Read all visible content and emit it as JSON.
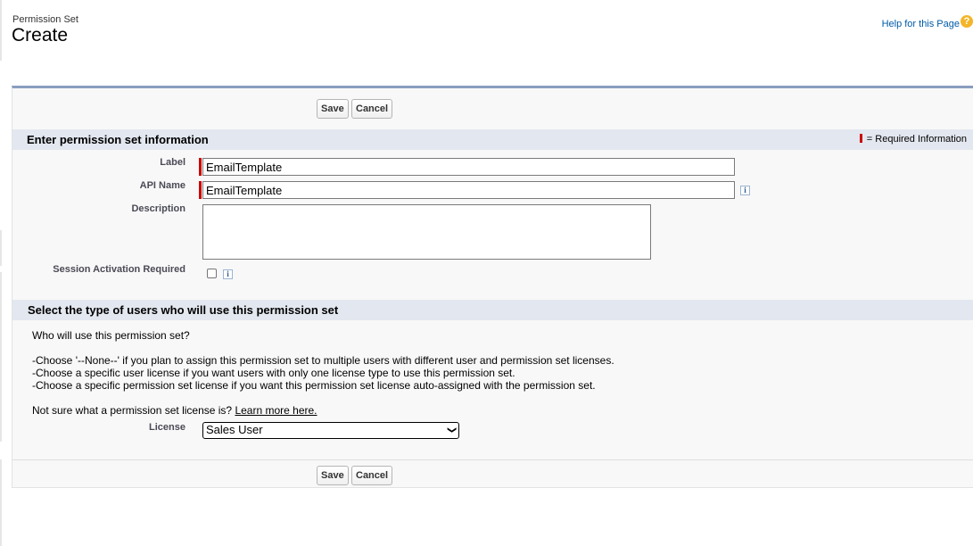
{
  "header": {
    "object_type": "Permission Set",
    "title": "Create",
    "help_link": "Help for this Page",
    "help_icon": "?"
  },
  "toolbar": {
    "save_label": "Save",
    "cancel_label": "Cancel"
  },
  "section_info": {
    "title": "Enter permission set information",
    "required_legend": "= Required Information",
    "fields": {
      "label": {
        "label": "Label",
        "value": "EmailTemplate"
      },
      "api_name": {
        "label": "API Name",
        "value": "EmailTemplate",
        "info_icon": "i"
      },
      "description": {
        "label": "Description",
        "value": ""
      },
      "session_activation": {
        "label": "Session Activation Required",
        "checked": false,
        "info_icon": "i"
      }
    }
  },
  "section_users": {
    "title": "Select the type of users who will use this permission set",
    "question": "Who will use this permission set?",
    "instructions": [
      "-Choose '--None--' if you plan to assign this permission set to multiple users with different user and permission set licenses.",
      "-Choose a specific user license if you want users with only one license type to use this permission set.",
      "-Choose a specific permission set license if you want this permission set license auto-assigned with the permission set."
    ],
    "not_sure_text": "Not sure what a permission set license is?",
    "learn_more": "Learn more here.",
    "license": {
      "label": "License",
      "selected": "Sales User"
    }
  },
  "colors": {
    "required": "#cc0000",
    "panel_border": "#8a9ebe",
    "section_header": "#e3e7ef",
    "link": "#015ba7"
  }
}
